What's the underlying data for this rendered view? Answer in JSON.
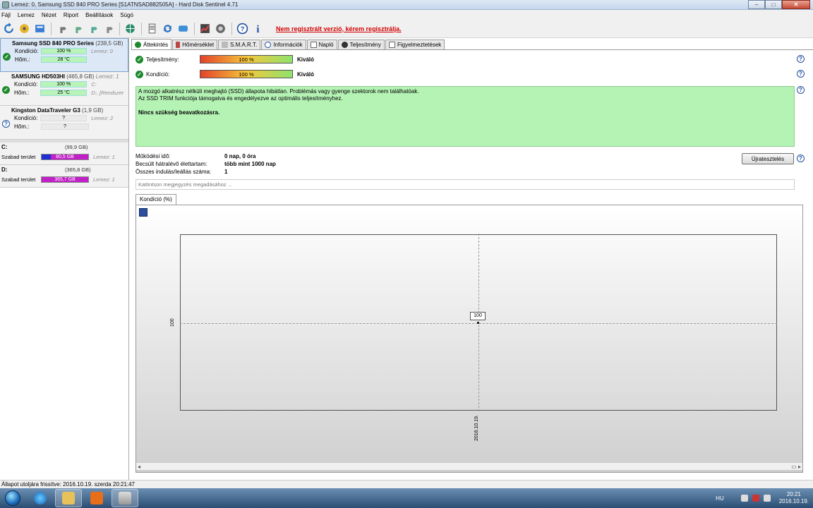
{
  "window": {
    "title": "Lemez: 0, Samsung SSD 840 PRO Series [S1ATNSAD882505A]  -  Hard Disk Sentinel 4.71"
  },
  "menu": [
    "Fájl",
    "Lemez",
    "Nézet",
    "Riport",
    "Beállítások",
    "Súgó"
  ],
  "toolbar": {
    "icons": [
      "refresh-icon",
      "disk-info-icon",
      "report-icon",
      "tool-icon",
      "tool2-icon",
      "tool3-icon",
      "tool4-icon",
      "globe-icon",
      "document-icon",
      "sync-icon",
      "transfer-icon",
      "chart-icon",
      "gauge-icon",
      "help-icon",
      "info-icon"
    ],
    "register_warning": "Nem regisztrált verzió, kérem regisztrálja."
  },
  "disks": [
    {
      "name": "Samsung SSD 840 PRO Series",
      "size": "(238,5 GB)",
      "kondicio_label": "Kondíció:",
      "kondicio": "100 %",
      "hom_label": "Hőm.:",
      "hom": "28 °C",
      "extra1": "Lemez: 0",
      "extra2": ""
    },
    {
      "name": "SAMSUNG HD503HI",
      "size": "(465,8 GB)",
      "extra0": "Lemez: 1",
      "kondicio_label": "Kondíció:",
      "kondicio": "100 %",
      "hom_label": "Hőm.:",
      "hom": "25 °C",
      "extra1": "C:",
      "extra2": "D:, [Rendszer"
    },
    {
      "name": "Kingston DataTraveler G3",
      "size": "(1,9 GB)",
      "kondicio_label": "Kondíció:",
      "kondicio": "?",
      "hom_label": "Hőm.:",
      "hom": "?",
      "extra1": "Lemez: 2",
      "extra2": ""
    }
  ],
  "partitions": [
    {
      "letter": "C:",
      "size": "(99,9 GB)",
      "free_label": "Szabad terület",
      "free": "80,5 GB",
      "disk": "Lemez: 1",
      "color": "#1d2fd1"
    },
    {
      "letter": "D:",
      "size": "(365,8 GB)",
      "free_label": "Szabad terület",
      "free": "365,7 GB",
      "disk": "Lemez: 1",
      "color": "#c11fc7"
    }
  ],
  "tabs": [
    "Áttekintés",
    "Hőmérséklet",
    "S.M.A.R.T.",
    "Információk",
    "Napló",
    "Teljesítmény",
    "Figyelmeztetések"
  ],
  "overview": {
    "teljesitmeny_label": "Teljesítmény:",
    "teljesitmeny_value": "100 %",
    "teljesitmeny_rating": "Kiváló",
    "kondicio_label": "Kondíció:",
    "kondicio_value": "100 %",
    "kondicio_rating": "Kiváló",
    "message_line1": "A mozgó alkatrész nélküli meghajtó (SSD) állapota hibátlan. Problémás vagy gyenge szektorok nem találhatóak.",
    "message_line2": "Az SSD TRIM funkciója támogatva és engedélyezve az optimális teljesítményhez.",
    "message_bold": "Nincs szükség beavatkozásra.",
    "uptime_label": "Működési idő:",
    "uptime_value": "0 nap, 0 óra",
    "lifetime_label": "Becsült hátralévő élettartam:",
    "lifetime_value": "több mint 1000 nap",
    "cycles_label": "Összes indulás/leállás száma:",
    "cycles_value": "1",
    "retest_button": "Újratesztelés",
    "note_placeholder": "Kattintson megjegyzés megadásához ..."
  },
  "chart_tab": "Kondíció  (%)",
  "chart_data": {
    "type": "line",
    "title": "",
    "xlabel": "",
    "ylabel": "",
    "x": [
      "2016.10.19."
    ],
    "series": [
      {
        "values": [
          100
        ]
      }
    ],
    "point_label": "100",
    "y_tick": "100",
    "x_tick": "2016.10.19."
  },
  "statusbar": "Állapot utoljára frissítve: 2016.10.19. szerda 20:21:47",
  "taskbar": {
    "lang": "HU",
    "time": "20:21",
    "date": "2016.10.19."
  }
}
